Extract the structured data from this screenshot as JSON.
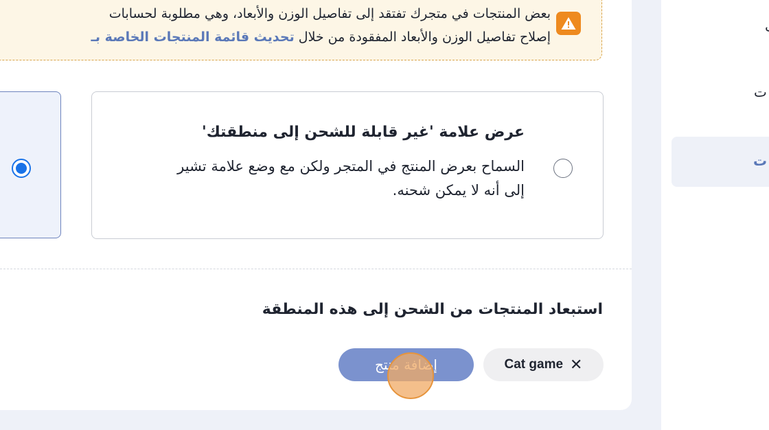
{
  "warning": {
    "line1": "بعض المنتجات في متجرك تفتقد إلى تفاصيل الوزن والأبعاد، وهي مطلوبة لحسابات",
    "line2_prefix": "إصلاح تفاصيل الوزن والأبعاد المفقودة من خلال ",
    "line2_link": "تحديث قائمة المنتجات الخاصة بـ"
  },
  "shipping_options": [
    {
      "title": "عرض علامة 'غير قابلة للشحن إلى منطقتك'",
      "description": "السماح بعرض المنتج في المتجر ولكن مع وضع علامة تشير إلى أنه لا يمكن شحنه.",
      "selected": false
    },
    {
      "selected": true
    }
  ],
  "exclude_section": {
    "title": "استبعاد المنتجات من الشحن إلى هذه المنطقة",
    "excluded_products": [
      {
        "label": "Cat game"
      }
    ],
    "add_button_label": "إضافة منتج"
  },
  "sidebar": {
    "fragment_1": "ى",
    "fragment_2": "ت",
    "fragment_3": "ت"
  },
  "colors": {
    "accent": "#7b92ce",
    "warning_icon": "#ee8a1f",
    "radio_selected": "#1a73e8",
    "link": "#5a78b8"
  }
}
